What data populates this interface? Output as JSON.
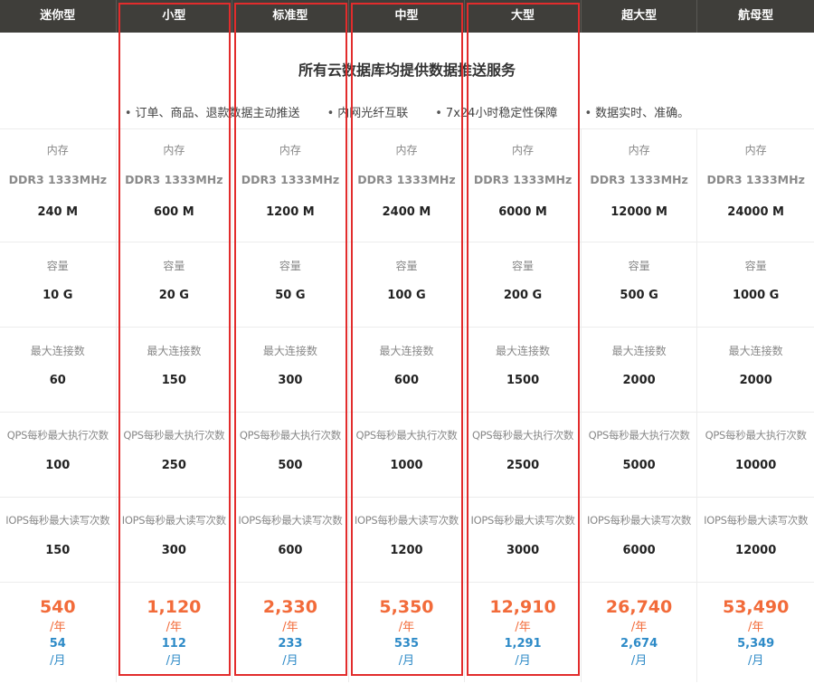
{
  "plans": [
    {
      "name": "迷你型",
      "mem_label": "内存",
      "mem_type": "DDR3 1333MHz",
      "memory": "240 M",
      "cap_label": "容量",
      "capacity": "10 G",
      "conn_label": "最大连接数",
      "max_connections": "60",
      "qps_label": "QPS每秒最大执行次数",
      "qps": "100",
      "iops_label": "IOPS每秒最大读写次数",
      "iops": "150",
      "price_year": "540",
      "year_unit": "/年",
      "price_month": "54",
      "month_unit": "/月",
      "highlighted": false
    },
    {
      "name": "小型",
      "mem_label": "内存",
      "mem_type": "DDR3 1333MHz",
      "memory": "600 M",
      "cap_label": "容量",
      "capacity": "20 G",
      "conn_label": "最大连接数",
      "max_connections": "150",
      "qps_label": "QPS每秒最大执行次数",
      "qps": "250",
      "iops_label": "IOPS每秒最大读写次数",
      "iops": "300",
      "price_year": "1,120",
      "year_unit": "/年",
      "price_month": "112",
      "month_unit": "/月",
      "highlighted": true
    },
    {
      "name": "标准型",
      "mem_label": "内存",
      "mem_type": "DDR3 1333MHz",
      "memory": "1200 M",
      "cap_label": "容量",
      "capacity": "50 G",
      "conn_label": "最大连接数",
      "max_connections": "300",
      "qps_label": "QPS每秒最大执行次数",
      "qps": "500",
      "iops_label": "IOPS每秒最大读写次数",
      "iops": "600",
      "price_year": "2,330",
      "year_unit": "/年",
      "price_month": "233",
      "month_unit": "/月",
      "highlighted": true
    },
    {
      "name": "中型",
      "mem_label": "内存",
      "mem_type": "DDR3 1333MHz",
      "memory": "2400 M",
      "cap_label": "容量",
      "capacity": "100 G",
      "conn_label": "最大连接数",
      "max_connections": "600",
      "qps_label": "QPS每秒最大执行次数",
      "qps": "1000",
      "iops_label": "IOPS每秒最大读写次数",
      "iops": "1200",
      "price_year": "5,350",
      "year_unit": "/年",
      "price_month": "535",
      "month_unit": "/月",
      "highlighted": true
    },
    {
      "name": "大型",
      "mem_label": "内存",
      "mem_type": "DDR3 1333MHz",
      "memory": "6000 M",
      "cap_label": "容量",
      "capacity": "200 G",
      "conn_label": "最大连接数",
      "max_connections": "1500",
      "qps_label": "QPS每秒最大执行次数",
      "qps": "2500",
      "iops_label": "IOPS每秒最大读写次数",
      "iops": "3000",
      "price_year": "12,910",
      "year_unit": "/年",
      "price_month": "1,291",
      "month_unit": "/月",
      "highlighted": true
    },
    {
      "name": "超大型",
      "mem_label": "内存",
      "mem_type": "DDR3 1333MHz",
      "memory": "12000 M",
      "cap_label": "容量",
      "capacity": "500 G",
      "conn_label": "最大连接数",
      "max_connections": "2000",
      "qps_label": "QPS每秒最大执行次数",
      "qps": "5000",
      "iops_label": "IOPS每秒最大读写次数",
      "iops": "6000",
      "price_year": "26,740",
      "year_unit": "/年",
      "price_month": "2,674",
      "month_unit": "/月",
      "highlighted": false
    },
    {
      "name": "航母型",
      "mem_label": "内存",
      "mem_type": "DDR3 1333MHz",
      "memory": "24000 M",
      "cap_label": "容量",
      "capacity": "1000 G",
      "conn_label": "最大连接数",
      "max_connections": "2000",
      "qps_label": "QPS每秒最大执行次数",
      "qps": "10000",
      "iops_label": "IOPS每秒最大读写次数",
      "iops": "12000",
      "price_year": "53,490",
      "year_unit": "/年",
      "price_month": "5,349",
      "month_unit": "/月",
      "highlighted": false
    }
  ],
  "banner": {
    "title": "所有云数据库均提供数据推送服务",
    "features": [
      "订单、商品、退款数据主动推送",
      "内网光纤互联",
      "7x24小时稳定性保障",
      "数据实时、准确。"
    ]
  },
  "colors": {
    "header_bg": "#3f3e3a",
    "price_year": "#f26b3a",
    "price_month": "#2d8ac7",
    "highlight_border": "#e22c2c"
  }
}
